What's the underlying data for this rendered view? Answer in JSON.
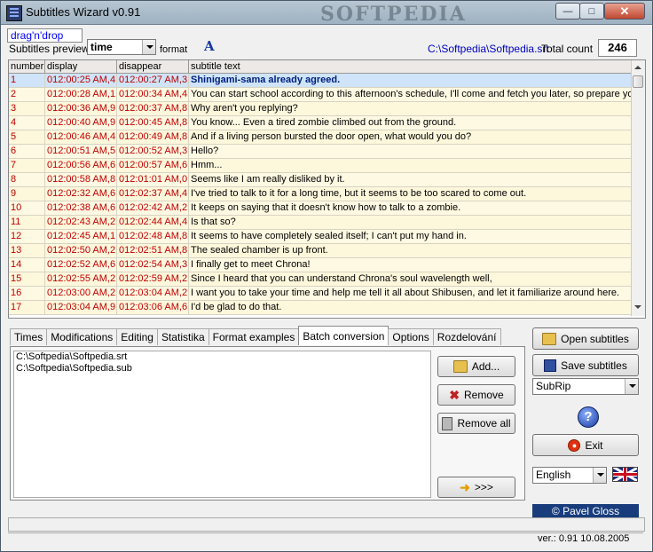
{
  "window": {
    "title": "Subtitles Wizard v0.91",
    "watermark": "SOFTPEDIA"
  },
  "toolbar": {
    "drag_label": "drag'n'drop",
    "preview_label": "Subtitles preview:",
    "preview_value": "time",
    "format_label": "format",
    "font_icon_glyph": "A",
    "file_path": "C:\\Softpedia\\Softpedia.srt",
    "total_label": "Total count",
    "total_value": "246"
  },
  "grid": {
    "columns": [
      "number",
      "display",
      "disappear",
      "subtitle text"
    ],
    "rows": [
      {
        "num": "1",
        "display": "012:00:25 AM,4",
        "disappear": "012:00:27 AM,3",
        "text": "Shinigami-sama already agreed."
      },
      {
        "num": "2",
        "display": "012:00:28 AM,1",
        "disappear": "012:00:34 AM,4",
        "text": "You can start school according to this afternoon's schedule, I'll come and fetch you later, so prepare your"
      },
      {
        "num": "3",
        "display": "012:00:36 AM,9",
        "disappear": "012:00:37 AM,8",
        "text": "Why aren't you replying?"
      },
      {
        "num": "4",
        "display": "012:00:40 AM,9",
        "disappear": "012:00:45 AM,8",
        "text": "You know... Even a tired zombie climbed out from the ground."
      },
      {
        "num": "5",
        "display": "012:00:46 AM,4",
        "disappear": "012:00:49 AM,8",
        "text": "And if a living person bursted the door open, what would you do?"
      },
      {
        "num": "6",
        "display": "012:00:51 AM,5",
        "disappear": "012:00:52 AM,3",
        "text": "Hello?"
      },
      {
        "num": "7",
        "display": "012:00:56 AM,6",
        "disappear": "012:00:57 AM,6",
        "text": "Hmm..."
      },
      {
        "num": "8",
        "display": "012:00:58 AM,8",
        "disappear": "012:01:01 AM,0",
        "text": "Seems like I am really disliked by it."
      },
      {
        "num": "9",
        "display": "012:02:32 AM,6",
        "disappear": "012:02:37 AM,4",
        "text": "I've tried to talk to it for a long time, but it seems to be too scared to come out."
      },
      {
        "num": "10",
        "display": "012:02:38 AM,6",
        "disappear": "012:02:42 AM,2",
        "text": "It keeps on saying that it doesn't know how to talk to a zombie."
      },
      {
        "num": "11",
        "display": "012:02:43 AM,2",
        "disappear": "012:02:44 AM,4",
        "text": "Is that so?"
      },
      {
        "num": "12",
        "display": "012:02:45 AM,1",
        "disappear": "012:02:48 AM,8",
        "text": "It seems to have completely sealed itself; I can't put my hand in."
      },
      {
        "num": "13",
        "display": "012:02:50 AM,2",
        "disappear": "012:02:51 AM,8",
        "text": "The sealed chamber is up front."
      },
      {
        "num": "14",
        "display": "012:02:52 AM,6",
        "disappear": "012:02:54 AM,3",
        "text": "I finally get to meet Chrona!"
      },
      {
        "num": "15",
        "display": "012:02:55 AM,2",
        "disappear": "012:02:59 AM,2",
        "text": "Since I heard that you can understand Chrona's soul wavelength well,"
      },
      {
        "num": "16",
        "display": "012:03:00 AM,2",
        "disappear": "012:03:04 AM,2",
        "text": "I want you to take your time and help me tell it all about Shibusen, and let it familiarize around here."
      },
      {
        "num": "17",
        "display": "012:03:04 AM,9",
        "disappear": "012:03:06 AM,6",
        "text": "I'd be glad to do that."
      }
    ]
  },
  "tabs": [
    "Times",
    "Modifications",
    "Editing",
    "Statistika",
    "Format examples",
    "Batch conversion",
    "Options",
    "Rozdelování"
  ],
  "active_tab": "Batch conversion",
  "batch": {
    "files": [
      "C:\\Softpedia\\Softpedia.srt",
      "C:\\Softpedia\\Softpedia.sub"
    ],
    "add_label": "Add...",
    "remove_label": "Remove",
    "remove_all_label": "Remove all",
    "go_label": ">>>"
  },
  "side": {
    "open_label": "Open subtitles",
    "save_label": "Save subtitles",
    "format_value": "SubRip",
    "help_glyph": "?",
    "exit_label": "Exit",
    "language_value": "English",
    "author": "© Pavel Gloss"
  },
  "status": {
    "version": "ver.: 0.91   10.08.2005"
  },
  "colors": {
    "accent": "#183c7c",
    "time_text": "#c00000",
    "link": "#0000c0"
  }
}
